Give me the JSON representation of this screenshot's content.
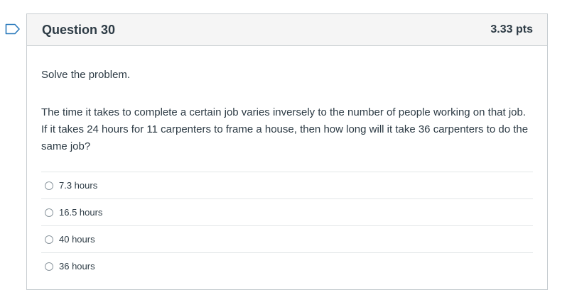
{
  "question": {
    "title": "Question 30",
    "points": "3.33 pts",
    "instructions": "Solve the problem.",
    "text": "The time it takes to complete a certain job varies inversely to the number of people working on that job. If it takes 24 hours for 11 carpenters to frame a house, then how long will it take 36 carpenters to do the same job?",
    "answers": [
      {
        "label": "7.3 hours"
      },
      {
        "label": "16.5 hours"
      },
      {
        "label": "40 hours"
      },
      {
        "label": "36 hours"
      }
    ]
  },
  "colors": {
    "flag": "#2b7abc",
    "border": "#c7cdd1",
    "header_bg": "#f5f5f5",
    "text": "#2d3b45"
  },
  "icons": {
    "flag": "flag-outline-icon"
  }
}
